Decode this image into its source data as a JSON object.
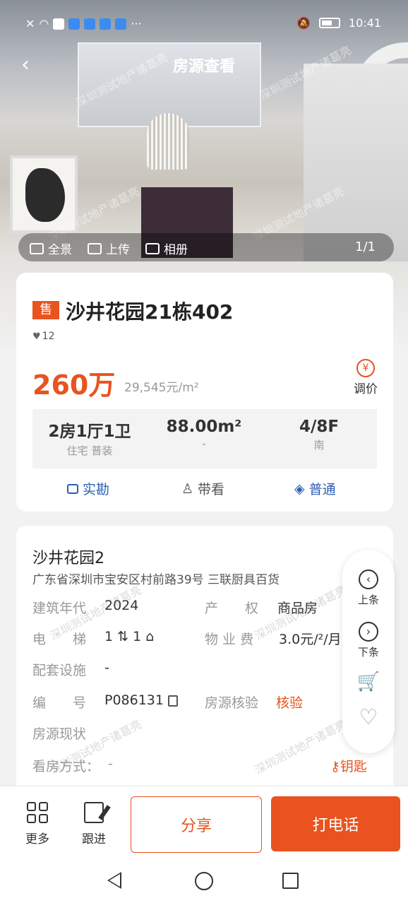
{
  "status_bar": {
    "time": "10:41",
    "more": "···"
  },
  "header": {
    "title": "房源查看",
    "back_icon": "chevron-left-icon"
  },
  "media_bar": {
    "items": [
      "全景",
      "上传",
      "相册"
    ],
    "page_indicator": "1/1"
  },
  "watermark": "深圳测试地产诸葛亮",
  "listing": {
    "tag": "售",
    "title": "沙井花园21栋402",
    "followers": "12",
    "price": "260万",
    "unit_price": "29,545元/m²",
    "adjust_label": "调价",
    "adjust_icon": "¥",
    "specs": [
      {
        "main": "2房1厅1卫",
        "sub": "住宅 普装"
      },
      {
        "main": "88.00m²",
        "sub": "-"
      },
      {
        "main": "4/8F",
        "sub": "南"
      }
    ],
    "actions": {
      "survey": "实勘",
      "showing": "带看",
      "level": "普通"
    }
  },
  "community": {
    "name": "沙井花园2",
    "address": "广东省深圳市宝安区村前路39号 三联厨具百货",
    "year_label": "建筑年代",
    "year": "2024",
    "rights_label": "产　　权",
    "rights": "商品房",
    "elevator_label": "电　　梯",
    "elevator": "1",
    "elevator_homes": "1",
    "fee_label": "物 业 费",
    "fee": "3.0元/²/月",
    "facilities_label": "配套设施",
    "facilities": "-",
    "code_label": "编　　号",
    "code": "P086131",
    "verify_label": "房源核验",
    "verify": "核验",
    "status_label": "房源现状",
    "viewing_label": "看房方式：",
    "viewing": "-",
    "key_label": "钥匙"
  },
  "float_nav": {
    "prev": "上条",
    "next": "下条"
  },
  "bottom_bar": {
    "more": "更多",
    "follow_up": "跟进",
    "share": "分享",
    "call": "打电话"
  },
  "colors": {
    "accent": "#e8531f",
    "link_blue": "#2d5fb3"
  }
}
